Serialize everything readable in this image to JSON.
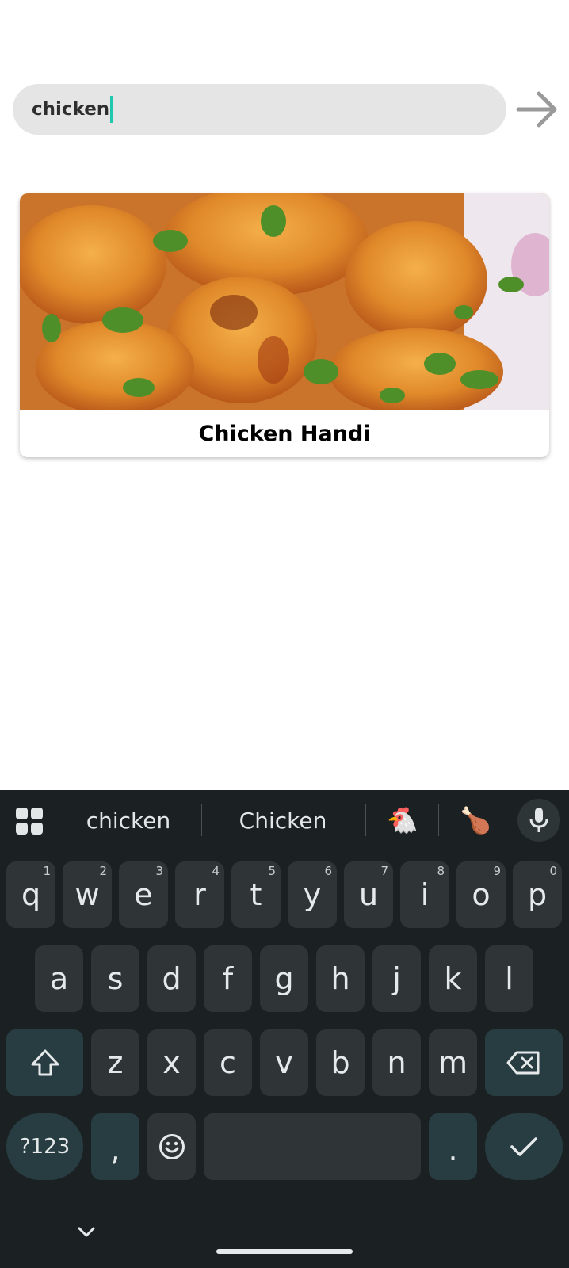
{
  "search": {
    "value": "chicken"
  },
  "results": [
    {
      "title": "Chicken Handi"
    }
  ],
  "keyboard": {
    "suggestions": [
      "chicken",
      "Chicken"
    ],
    "emoji_suggestions": [
      "🐔",
      "🍗"
    ],
    "row1": [
      {
        "key": "q",
        "hint": "1"
      },
      {
        "key": "w",
        "hint": "2"
      },
      {
        "key": "e",
        "hint": "3"
      },
      {
        "key": "r",
        "hint": "4"
      },
      {
        "key": "t",
        "hint": "5"
      },
      {
        "key": "y",
        "hint": "6"
      },
      {
        "key": "u",
        "hint": "7"
      },
      {
        "key": "i",
        "hint": "8"
      },
      {
        "key": "o",
        "hint": "9"
      },
      {
        "key": "p",
        "hint": "0"
      }
    ],
    "row2": [
      "a",
      "s",
      "d",
      "f",
      "g",
      "h",
      "j",
      "k",
      "l"
    ],
    "row3": [
      "z",
      "x",
      "c",
      "v",
      "b",
      "n",
      "m"
    ],
    "symbols_label": "?123",
    "comma_label": ",",
    "period_label": "."
  },
  "icons": {
    "go": "arrow-right-icon",
    "apps": "apps-grid-icon",
    "mic": "microphone-icon",
    "shift": "shift-icon",
    "backspace": "backspace-icon",
    "emoji": "smiley-icon",
    "enter": "checkmark-icon",
    "hide_keyboard": "chevron-down-icon"
  },
  "colors": {
    "caret": "#1ec7b0",
    "keyboard_bg": "#1b2022",
    "key_bg": "#2f3537",
    "function_key_bg": "#283d42"
  }
}
